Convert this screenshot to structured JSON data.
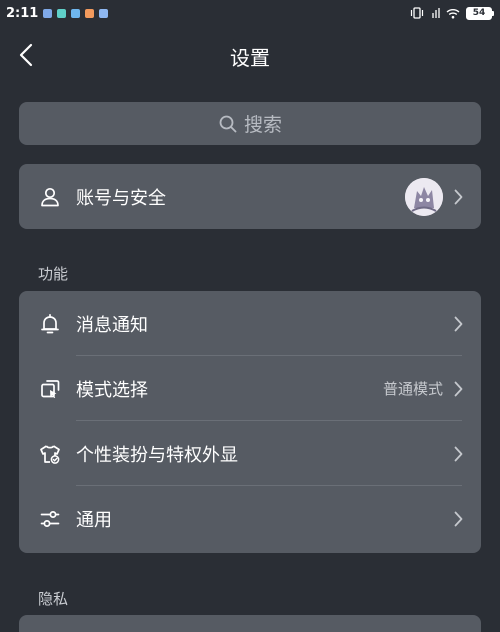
{
  "status_bar": {
    "time": "2:11",
    "battery": "54"
  },
  "header": {
    "title": "设置"
  },
  "search": {
    "placeholder": "搜索"
  },
  "account": {
    "label": "账号与安全"
  },
  "sections": {
    "features": {
      "title": "功能",
      "items": [
        {
          "label": "消息通知",
          "value": ""
        },
        {
          "label": "模式选择",
          "value": "普通模式"
        },
        {
          "label": "个性装扮与特权外显",
          "value": ""
        },
        {
          "label": "通用",
          "value": ""
        }
      ]
    },
    "privacy": {
      "title": "隐私"
    }
  },
  "colors": {
    "background": "#2a2e35",
    "card": "#565b63",
    "text_primary": "#ffffff",
    "text_secondary": "#c9ccd1"
  }
}
